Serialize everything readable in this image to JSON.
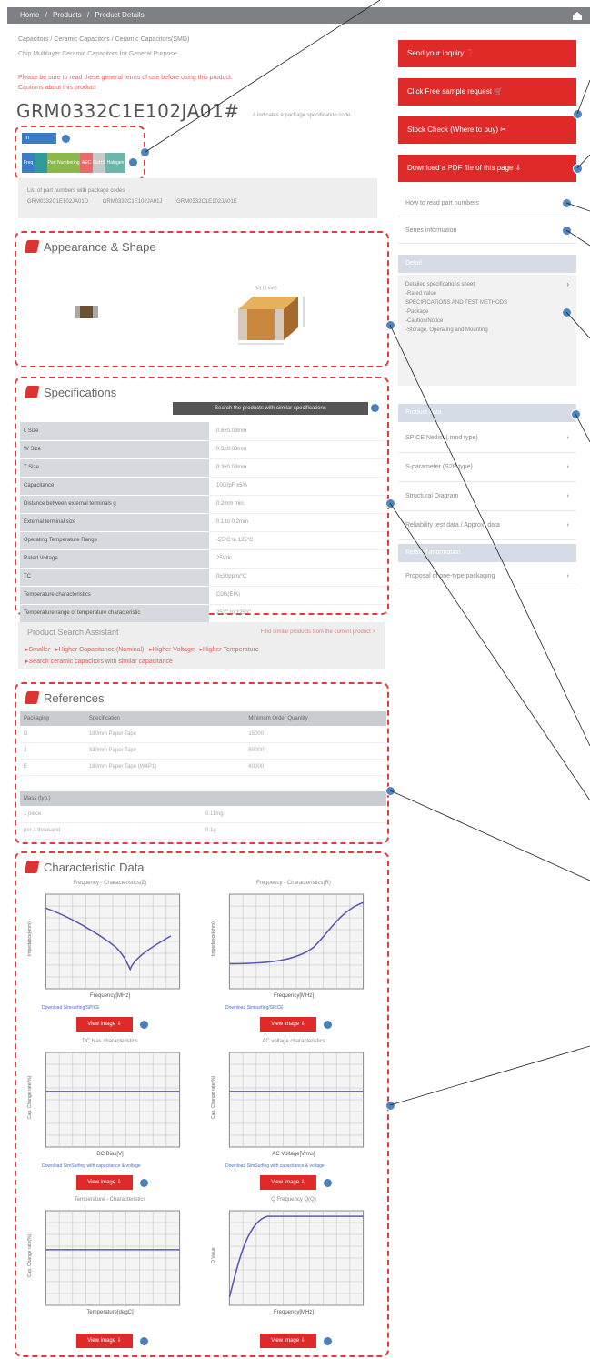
{
  "topbar": {
    "crumbs": [
      "Home",
      "/",
      "Products",
      "/",
      "Product Details"
    ]
  },
  "page": {
    "breadcrumb": "Capacitors  /  Ceramic Capacitors  /  Ceramic Capacitors(SMD)",
    "subtitle": "Chip Multilayer Ceramic Capacitors for General Purpose",
    "notice_line1": "Please be sure to read these general terms of use before using this product.",
    "notice_line2": "Cautions about this product",
    "part_number": "GRM0332C1E102JA01#",
    "part_note": "# indicates a package specification code."
  },
  "badges": {
    "primary": "In Production",
    "strip": [
      "Freq",
      "Part Numbering",
      "AEC",
      "RoHS",
      "Halogen Free"
    ]
  },
  "related": {
    "title": "List of part numbers with package codes",
    "items": [
      "GRM0332C1E102JA01D",
      "GRM0332C1E102JA01J",
      "GRM0332C1E102JA01E"
    ]
  },
  "sections": {
    "appearance": "Appearance & Shape",
    "specs": "Specifications",
    "references": "References",
    "characteristics": "Characteristic Data"
  },
  "appearance": {
    "dims": "(in)    ( )    mm)"
  },
  "specs": {
    "search_button": "Search the products with similar specifications",
    "rows": [
      [
        "L Size",
        "0.6±0.03mm"
      ],
      [
        "W Size",
        "0.3±0.03mm"
      ],
      [
        "T Size",
        "0.3±0.03mm"
      ],
      [
        "Capacitance",
        "1000pF ±5%"
      ],
      [
        "Distance between external terminals g",
        "0.2mm min."
      ],
      [
        "External terminal size",
        "0.1 to 0.2mm"
      ],
      [
        "Operating Temperature Range",
        "-55°C to 125°C"
      ],
      [
        "Rated Voltage",
        "25Vdc"
      ],
      [
        "TC",
        "0±30ppm/°C"
      ],
      [
        "Temperature characteristics",
        "C0G(EIA)"
      ],
      [
        "Temperature range of temperature characteristic",
        "25°C to 125°C"
      ]
    ]
  },
  "assist": {
    "title": "Product Search Assistant",
    "right": "Find similar products from the current product >",
    "links": [
      "Smaller",
      "Higher Capacitance (Nominal)",
      "Higher Voltage",
      "Higher Temperature",
      "Search ceramic capacitors with similar capacitance"
    ]
  },
  "references": {
    "packaging_headers": [
      "Packaging",
      "Specification",
      "Minimum Order Quantity"
    ],
    "packaging_rows": [
      [
        "D",
        "180mm Paper Tape",
        "15000"
      ],
      [
        "J",
        "330mm Paper Tape",
        "50000"
      ],
      [
        "E",
        "180mm Paper Tape (W4P1)",
        "40000"
      ]
    ],
    "mass_headers": [
      "Mass (typ.)",
      ""
    ],
    "mass_rows": [
      [
        "1 piece",
        "0.11mg"
      ],
      [
        "per 1 thousand",
        "0.1g"
      ]
    ]
  },
  "sidebar": {
    "buttons": [
      "Send your inquiry",
      "Click Free sample request",
      "Stock Check (Where to buy)",
      "Download a PDF file of this page"
    ],
    "links": [
      "How to read part numbers",
      "Series information"
    ],
    "detail_head": "Detail",
    "detail_text": "Detailed specifications sheet\n-Rated value\nSPECIFICATIONS AND TEST METHODS\n-Package\n-Caution/Notice\n-Storage, Operating and Mounting",
    "product_data_head": "Product data",
    "product_data_items": [
      "SPICE Netlist (.mod type)",
      "S-parameter (S2P type)",
      "Structural Diagram",
      "Reliability test data / Approx. data"
    ],
    "related_head": "Related information",
    "related_items": [
      "Proposal of one-type packaging"
    ]
  },
  "charts": {
    "items": [
      {
        "title": "Frequency - Characteristics(Z)",
        "ylabel": "Impedance(ohm)",
        "xlabel": "Frequency[MHz]",
        "download": "Download Simsurfing/SPICE"
      },
      {
        "title": "Frequency - Characteristics(R)",
        "ylabel": "Impedance(ohm)",
        "xlabel": "Frequency[MHz]",
        "download": "Download Simsurfing/SPICE"
      },
      {
        "title": "DC bias characteristics",
        "ylabel": "Cap. Change rate(%)",
        "xlabel": "DC Bias[V]",
        "download": "Download SimSurfing with capacitance & voltage"
      },
      {
        "title": "AC voltage characteristics",
        "ylabel": "Cap. Change rate(%)",
        "xlabel": "AC Voltage[Vrms]",
        "download": "Download SimSurfing with capacitance & voltage"
      },
      {
        "title": "Temperature - Characteristics",
        "ylabel": "Cap. Change rate(%)",
        "xlabel": "Temperature[degC]",
        "download": ""
      },
      {
        "title": "Q Frequency Q(Q)",
        "ylabel": "Q Value",
        "xlabel": "Frequency[MHz]",
        "download": ""
      }
    ],
    "view_label": "View image"
  }
}
